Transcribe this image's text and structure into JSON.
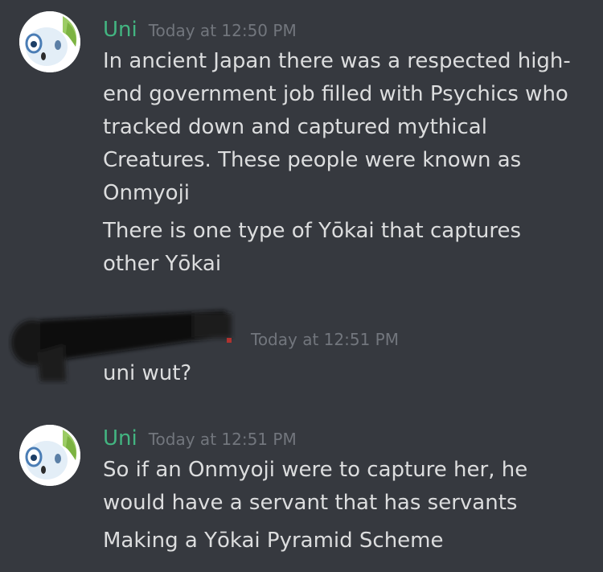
{
  "messages": [
    {
      "author": "Uni",
      "timestamp": "Today at 12:50 PM",
      "paragraphs": [
        [
          "In ancient Japan there was a respected high-",
          "end government job filled with Psychics who",
          "tracked down and captured mythical",
          "Creatures. These people were known as",
          "Onmyoji"
        ],
        [
          "There is one type of  Yōkai that captures",
          "other Yōkai"
        ]
      ]
    },
    {
      "author": "",
      "timestamp": "Today at 12:51 PM",
      "paragraphs": [
        [
          "uni wut?"
        ]
      ]
    },
    {
      "author": "Uni",
      "timestamp": "Today at 12:51 PM",
      "paragraphs": [
        [
          "So if an Onmyoji were to capture her, he",
          "would have a servant that has servants"
        ],
        [
          "Making a Yōkai Pyramid Scheme"
        ]
      ]
    }
  ],
  "colors": {
    "background": "#36393f",
    "username": "#43b581",
    "timestamp": "#72767d",
    "text": "#dcddde",
    "redaction": "#0c0c0c"
  },
  "icons": {
    "avatar": "pokemon-avatar-icon"
  }
}
